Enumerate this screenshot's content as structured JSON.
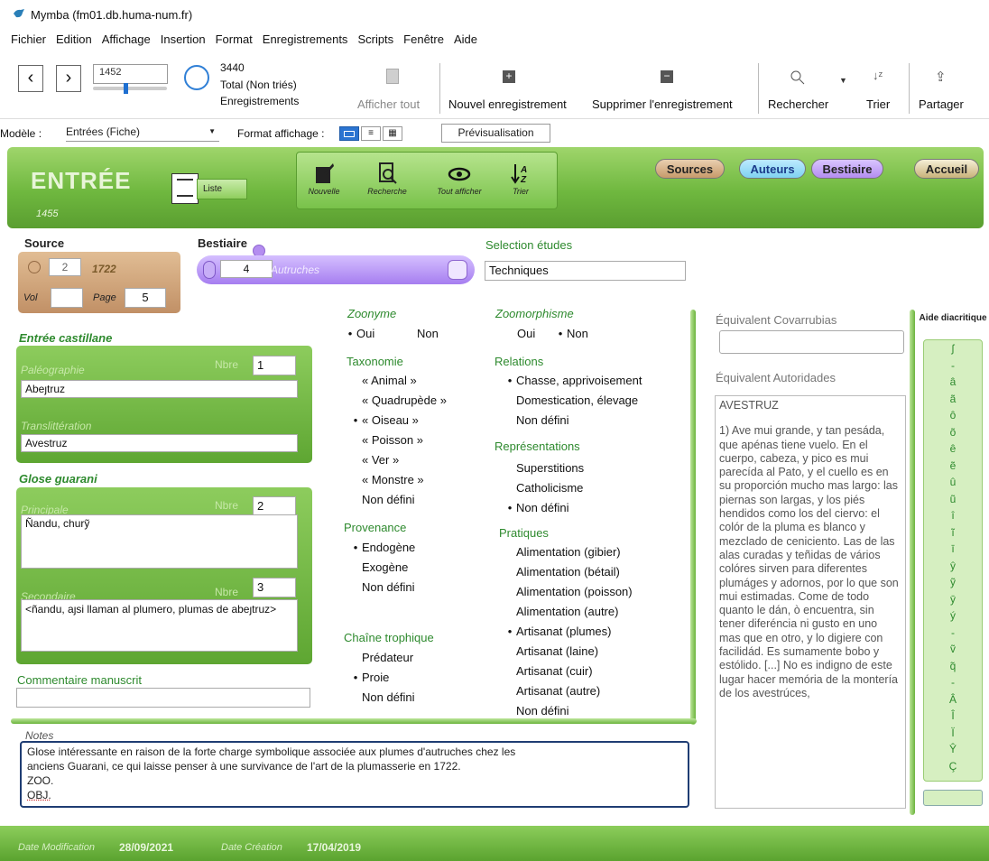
{
  "window": {
    "title": "Mymba (fm01.db.huma-num.fr)"
  },
  "menu": [
    "Fichier",
    "Edition",
    "Affichage",
    "Insertion",
    "Format",
    "Enregistrements",
    "Scripts",
    "Fenêtre",
    "Aide"
  ],
  "toolbar": {
    "record_number": "1452",
    "total_count": "3440",
    "total_label": "Total (Non triés)",
    "records_label": "Enregistrements",
    "show_all": "Afficher tout",
    "new_record": "Nouvel enregistrement",
    "delete_record": "Supprimer l'enregistrement",
    "search": "Rechercher",
    "sort": "Trier",
    "share": "Partager",
    "slider_fraction": 0.42
  },
  "modelbar": {
    "model_label": "Modèle :",
    "model_value": "Entrées (Fiche)",
    "format_label": "Format affichage :",
    "preview": "Prévisualisation"
  },
  "header": {
    "title": "ENTRÉE",
    "record_id": "1455",
    "list_button": "Liste",
    "tools": [
      "Nouvelle",
      "Recherche",
      "Tout afficher",
      "Trier"
    ],
    "nav": [
      "Sources",
      "Auteurs",
      "Bestiaire",
      "Accueil"
    ]
  },
  "source": {
    "label": "Source",
    "num": "2",
    "year": "1722",
    "vol_label": "Vol",
    "vol": "",
    "page_label": "Page",
    "page": "5"
  },
  "bestiaire": {
    "label": "Bestiaire",
    "num": "4",
    "name": "Autruches"
  },
  "etudes": {
    "label": "Selection études",
    "value": "Techniques"
  },
  "castillane": {
    "label": "Entrée castillane",
    "paleo_label": "Paléographie",
    "nbre_label": "Nbre",
    "nbre": "1",
    "paleo": "Abeȷtruz",
    "translit_label": "Translittération",
    "translit": "Avestruz"
  },
  "guarani": {
    "label": "Glose guarani",
    "principale_label": "Principale",
    "nbre_label": "Nbre",
    "nbre1": "2",
    "principale": "Ñandu, churỹ",
    "secondaire_label": "Secondaire",
    "nbre2": "3",
    "secondaire": "<ñandu, aȷsi llaman al plumero, plumas de abeȷtruz>"
  },
  "commentaire": {
    "label": "Commentaire manuscrit",
    "value": ""
  },
  "zoonyme": {
    "label": "Zoonyme",
    "oui": "Oui",
    "non": "Non"
  },
  "taxonomie": {
    "label": "Taxonomie",
    "items": [
      "« Animal »",
      "« Quadrupède »",
      "« Oiseau »",
      "« Poisson »",
      "« Ver »",
      "« Monstre »",
      "Non défini"
    ]
  },
  "provenance": {
    "label": "Provenance",
    "items": [
      "Endogène",
      "Exogène",
      "Non défini"
    ]
  },
  "chaine": {
    "label": "Chaîne trophique",
    "items": [
      "Prédateur",
      "Proie",
      "Non défini"
    ]
  },
  "zoomorphisme": {
    "label": "Zoomorphisme",
    "oui": "Oui",
    "non": "Non"
  },
  "relations": {
    "label": "Relations",
    "items": [
      "Chasse, apprivoisement",
      "Domestication, élevage",
      "Non défini"
    ]
  },
  "representations": {
    "label": "Représentations",
    "items": [
      "Superstitions",
      "Catholicisme",
      "Non défini"
    ]
  },
  "pratiques": {
    "label": "Pratiques",
    "items": [
      "Alimentation (gibier)",
      "Alimentation (bétail)",
      "Alimentation (poisson)",
      "Alimentation (autre)",
      "Artisanat (plumes)",
      "Artisanat (laine)",
      "Artisanat (cuir)",
      "Artisanat (autre)",
      "Non défini"
    ]
  },
  "covarrubias": {
    "label": "Équivalent Covarrubias",
    "value": ""
  },
  "autoridades": {
    "label": "Équivalent Autoridades",
    "head": "AVESTRUZ",
    "text": "1) Ave mui grande, y tan pesáda, que apénas tiene vuelo. En el cuerpo, cabeza, y pico es mui parecída al Pato, y el cuello es en su proporción mucho mas largo: las piernas son largas, y los piés hendidos como los del ciervo: el colór de la pluma es blanco y mezclado de ceniciento. Las de las alas curadas y teñidas de vários colóres sirven para diferentes plumáges y adornos, por lo que son mui estimadas. Come de todo quanto le dán, ò encuentra, sin tener diferéncia ni gusto en uno mas que en otro, y lo digiere con facilidád. Es sumamente bobo y estólido. [...] No es indigno de este lugar hacer memória de la montería de los avestrúces,"
  },
  "aide": {
    "label": "Aide diacritique",
    "chars": [
      "ʃ",
      "-",
      "â",
      "ã",
      "ô",
      "õ",
      "ê",
      "ẽ",
      "û",
      "ũ",
      "î",
      "ĩ",
      "ī",
      "ŷ",
      "ỹ",
      "ȳ",
      "ý",
      "-",
      "ṽ",
      "q̃",
      "-",
      "Â",
      "Î",
      "Ï",
      "Ŷ",
      "Ç"
    ]
  },
  "notes": {
    "label": "Notes",
    "line1": "Glose intéressante en raison de la forte charge symbolique associée aux plumes d'autruches chez les",
    "line2": "anciens Guarani, ce qui laisse penser à une survivance de l'art de la plumasserie en 1722.",
    "line3": "ZOO.",
    "line4": "OBJ."
  },
  "footer": {
    "mod_label": "Date Modification",
    "mod": "28/09/2021",
    "cre_label": "Date Création",
    "cre": "17/04/2019"
  },
  "colors": {
    "green": "#6fb83f",
    "green_text": "#2e8a2e",
    "source_brown": "#c79a6a",
    "bestiaire_purple": "#b48df0",
    "auteurs_blue": "#7fd2f0"
  }
}
